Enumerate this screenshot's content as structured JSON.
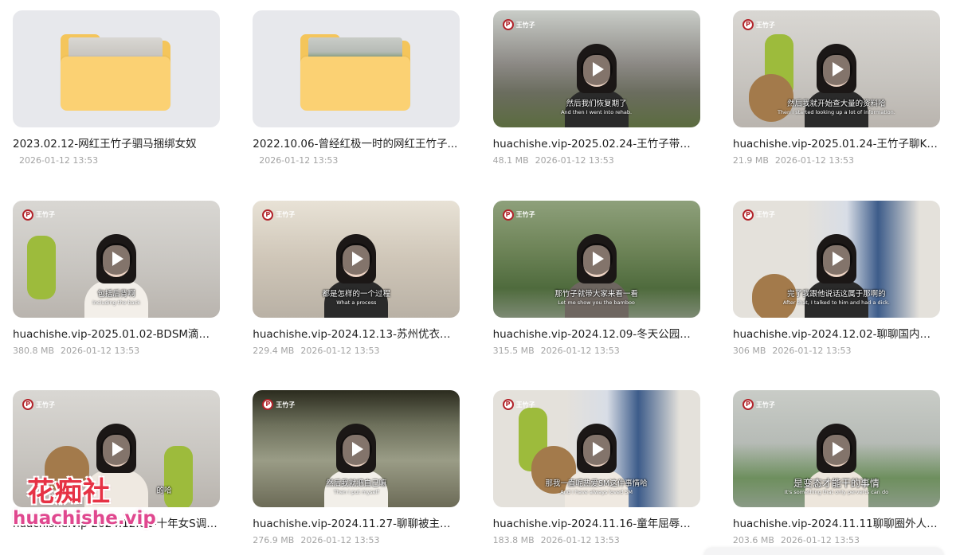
{
  "items": [
    {
      "title": "2023.02.12-网红王竹子驷马捆绑女奴",
      "size": "",
      "date": "2026-01-12 13:53",
      "kind": "folder"
    },
    {
      "title": "2022.10.06-曾经红极一时的网红王竹子...",
      "size": "",
      "date": "2026-01-12 13:53",
      "kind": "folder"
    },
    {
      "title": "huachishe.vip-2025.02.24-王竹子带尿...",
      "size": "48.1 MB",
      "date": "2026-01-12 13:53",
      "kind": "video",
      "sub_zh": "然后我们恢复期了",
      "sub_en": "And then I went into rehab."
    },
    {
      "title": "huachishe.vip-2025.01.24-王竹子聊K9...",
      "size": "21.9 MB",
      "date": "2026-01-12 13:53",
      "kind": "video",
      "sub_zh": "然后我就开始查大量的资料哈",
      "sub_en": "Then I started looking up a lot of information."
    },
    {
      "title": "huachishe.vip-2025.01.02-BDSM滴蜡演...",
      "size": "380.8 MB",
      "date": "2026-01-12 13:53",
      "kind": "video",
      "sub_zh": "包括后背啊",
      "sub_en": "Including the back"
    },
    {
      "title": "huachishe.vip-2024.12.13-苏州优衣库...",
      "size": "229.4 MB",
      "date": "2026-01-12 13:53",
      "kind": "video",
      "sub_zh": "都是怎样的一个过程",
      "sub_en": "What a process"
    },
    {
      "title": "huachishe.vip-2024.12.09-冬天公园调...",
      "size": "315.5 MB",
      "date": "2026-01-12 13:53",
      "kind": "video",
      "sub_zh": "那竹子就带大家来看一看",
      "sub_en": "Let me show you the bamboo"
    },
    {
      "title": "huachishe.vip-2024.12.02-聊聊国内圈...",
      "size": "306 MB",
      "date": "2026-01-12 13:53",
      "kind": "video",
      "sub_zh": "完了我跟他说话这属于那啊的",
      "sub_en": "After that, I talked to him and had a dick."
    },
    {
      "title": "huachishe.vip-2024.12.01-十年女S调教...",
      "size": "",
      "date": "",
      "kind": "video",
      "sub_zh": "的哈",
      "sub_en": ""
    },
    {
      "title": "huachishe.vip-2024.11.27-聊聊被主人装...",
      "size": "276.9 MB",
      "date": "2026-01-12 13:53",
      "kind": "video",
      "sub_zh": "然后我就把自己嘛",
      "sub_en": "Then I put myself"
    },
    {
      "title": "huachishe.vip-2024.11.16-童年屈辱经历...",
      "size": "183.8 MB",
      "date": "2026-01-12 13:53",
      "kind": "video",
      "sub_zh": "那我一直呢热爱SM这件事情哈",
      "sub_en": "And I have always loved SM"
    },
    {
      "title": "huachishe.vip-2024.11.11聊聊圈外人🉐...",
      "size": "203.6 MB",
      "date": "2026-01-12 13:53",
      "kind": "video",
      "sub_zh": "是变态才能干的事情",
      "sub_en": "It's something that only perverts can do"
    }
  ],
  "channel_badge": "王竹子",
  "watermark": {
    "cn": "花痴社",
    "url": "huachishe.vip"
  },
  "colors": {
    "folder": "#f4c55b",
    "folder_front": "#fbd173",
    "watermark_red": "#e63245",
    "watermark_pink": "#e0488f"
  }
}
